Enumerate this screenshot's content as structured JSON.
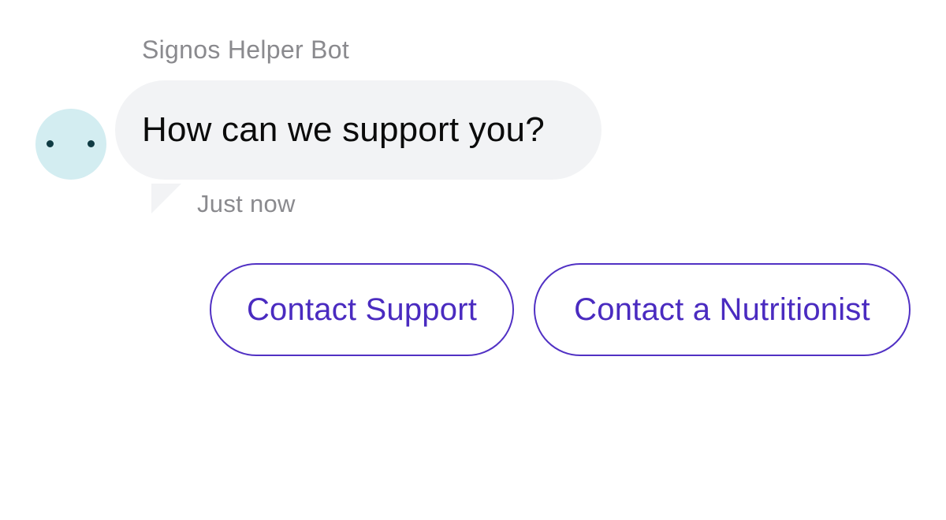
{
  "message": {
    "sender": "Signos Helper Bot",
    "text": "How can we support you?",
    "timestamp": "Just now",
    "avatar_icon": "bot-face-icon",
    "bubble_color": "#f2f3f5",
    "avatar_color": "#d3edf1"
  },
  "quick_replies": [
    {
      "label": "Contact Support"
    },
    {
      "label": "Contact a Nutritionist"
    }
  ],
  "colors": {
    "accent": "#4a2bc0",
    "secondary_text": "#8a8a8e",
    "primary_text": "#0b0b0b"
  }
}
